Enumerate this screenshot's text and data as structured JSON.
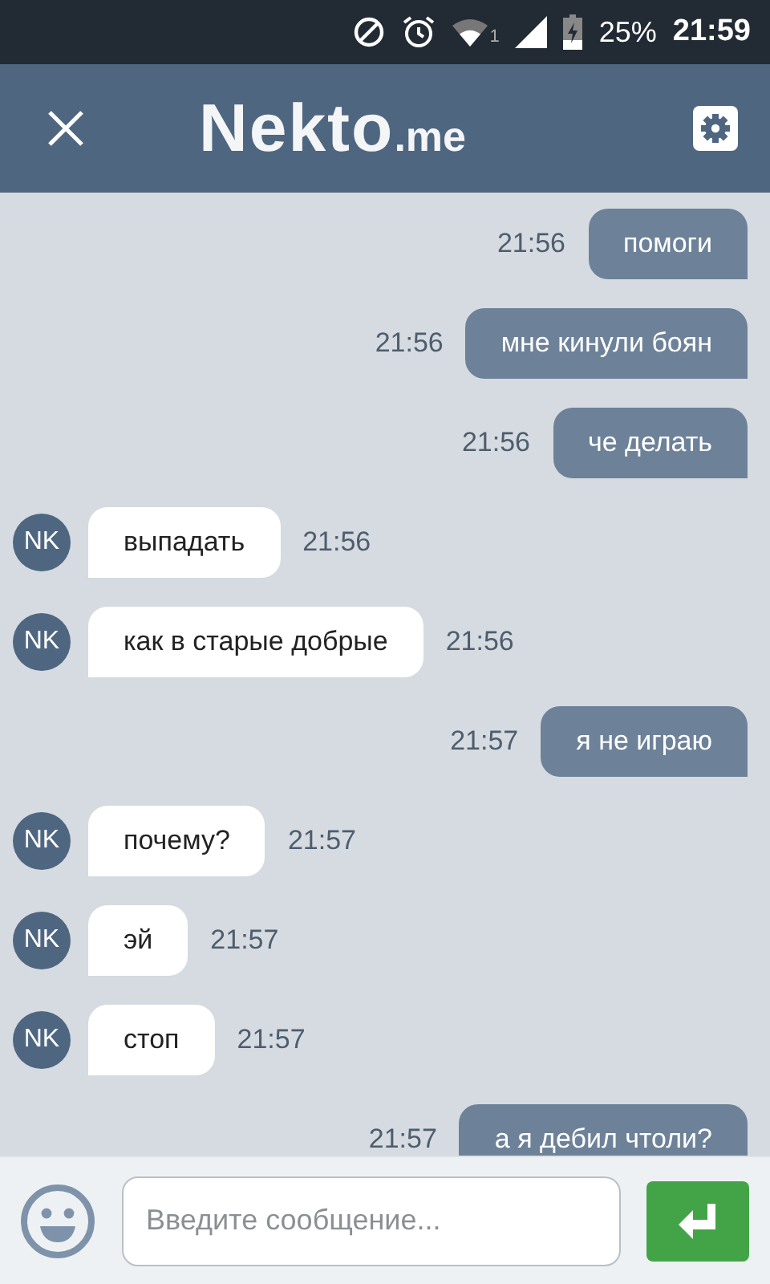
{
  "status_bar": {
    "wifi_badge": "1",
    "battery": "25%",
    "time": "21:59"
  },
  "header": {
    "logo_main": "Nekto",
    "logo_suffix": ".me"
  },
  "messages": [
    {
      "kind": "outgoing",
      "text": "помоги",
      "time": "21:56"
    },
    {
      "kind": "outgoing",
      "text": "мне кинули боян",
      "time": "21:56"
    },
    {
      "kind": "outgoing",
      "text": "че делать",
      "time": "21:56"
    },
    {
      "kind": "incoming",
      "avatar": "NK",
      "text": "выпадать",
      "time": "21:56"
    },
    {
      "kind": "incoming",
      "avatar": "NK",
      "text": "как в старые добрые",
      "time": "21:56"
    },
    {
      "kind": "outgoing",
      "text": "я не играю",
      "time": "21:57"
    },
    {
      "kind": "incoming",
      "avatar": "NK",
      "text": "почему?",
      "time": "21:57"
    },
    {
      "kind": "incoming",
      "avatar": "NK",
      "text": "эй",
      "time": "21:57"
    },
    {
      "kind": "incoming",
      "avatar": "NK",
      "text": "стоп",
      "time": "21:57"
    },
    {
      "kind": "outgoing",
      "text": "а я дебил чтоли?",
      "time": "21:57"
    }
  ],
  "composer": {
    "placeholder": "Введите сообщение..."
  }
}
